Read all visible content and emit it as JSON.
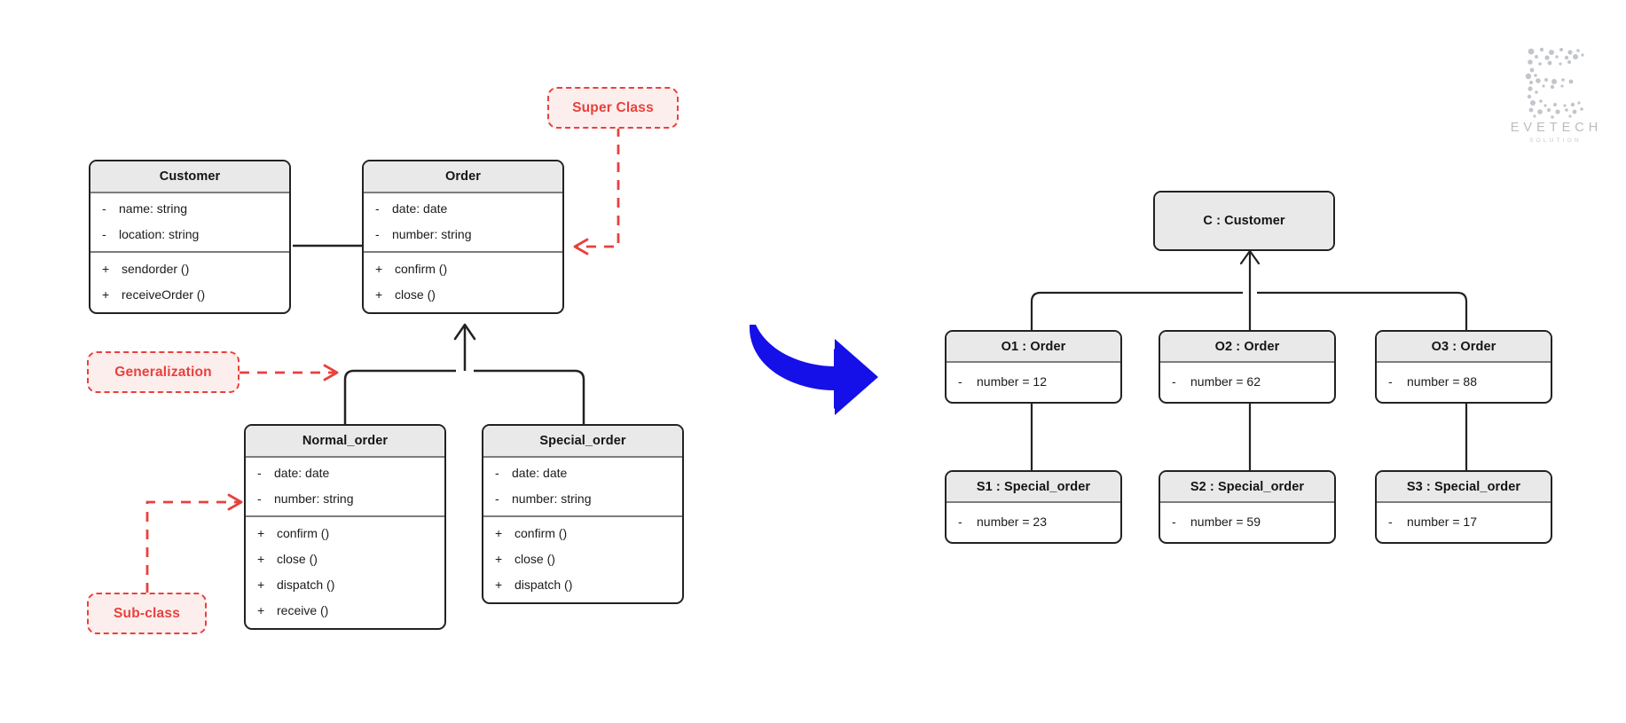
{
  "class_diagram": {
    "classes": [
      {
        "name": "Customer",
        "attributes": [
          {
            "visibility": "-",
            "text": "name: string"
          },
          {
            "visibility": "-",
            "text": "location: string"
          }
        ],
        "methods": [
          {
            "visibility": "+",
            "text": "sendorder ()"
          },
          {
            "visibility": "+",
            "text": "receiveOrder ()"
          }
        ]
      },
      {
        "name": "Order",
        "attributes": [
          {
            "visibility": "-",
            "text": "date: date"
          },
          {
            "visibility": "-",
            "text": "number: string"
          }
        ],
        "methods": [
          {
            "visibility": "+",
            "text": "confirm ()"
          },
          {
            "visibility": "+",
            "text": "close ()"
          }
        ]
      },
      {
        "name": "Normal_order",
        "attributes": [
          {
            "visibility": "-",
            "text": "date: date"
          },
          {
            "visibility": "-",
            "text": "number: string"
          }
        ],
        "methods": [
          {
            "visibility": "+",
            "text": "confirm ()"
          },
          {
            "visibility": "+",
            "text": "close ()"
          },
          {
            "visibility": "+",
            "text": "dispatch ()"
          },
          {
            "visibility": "+",
            "text": "receive ()"
          }
        ]
      },
      {
        "name": "Special_order",
        "attributes": [
          {
            "visibility": "-",
            "text": "date: date"
          },
          {
            "visibility": "-",
            "text": "number: string"
          }
        ],
        "methods": [
          {
            "visibility": "+",
            "text": "confirm ()"
          },
          {
            "visibility": "+",
            "text": "close ()"
          },
          {
            "visibility": "+",
            "text": "dispatch ()"
          }
        ]
      }
    ],
    "annotations": [
      {
        "id": "super-class",
        "label": "Super Class"
      },
      {
        "id": "generalization",
        "label": "Generalization"
      },
      {
        "id": "sub-class",
        "label": "Sub-class"
      }
    ]
  },
  "object_diagram": {
    "root": {
      "name": "C : Customer"
    },
    "orders": [
      {
        "name": "O1 : Order",
        "visibility": "-",
        "attribute": "number = 12"
      },
      {
        "name": "O2 : Order",
        "visibility": "-",
        "attribute": "number = 62"
      },
      {
        "name": "O3 : Order",
        "visibility": "-",
        "attribute": "number = 88"
      }
    ],
    "special_orders": [
      {
        "name": "S1 : Special_order",
        "visibility": "-",
        "attribute": "number = 23"
      },
      {
        "name": "S2 : Special_order",
        "visibility": "-",
        "attribute": "number = 59"
      },
      {
        "name": "S3 : Special_order",
        "visibility": "-",
        "attribute": "number = 17"
      }
    ]
  },
  "transform_arrow": {
    "icon": "right-arrow-icon",
    "color": "#1510e8"
  },
  "watermark": {
    "logo_letter": "E",
    "brand": "EVETECH",
    "tagline": "SOLUTION"
  },
  "colors": {
    "accent_red": "#e8413c",
    "note_fill": "#fdeeee",
    "header_fill": "#e9e9e9",
    "stroke": "#222222",
    "arrow_blue": "#1510e8"
  }
}
